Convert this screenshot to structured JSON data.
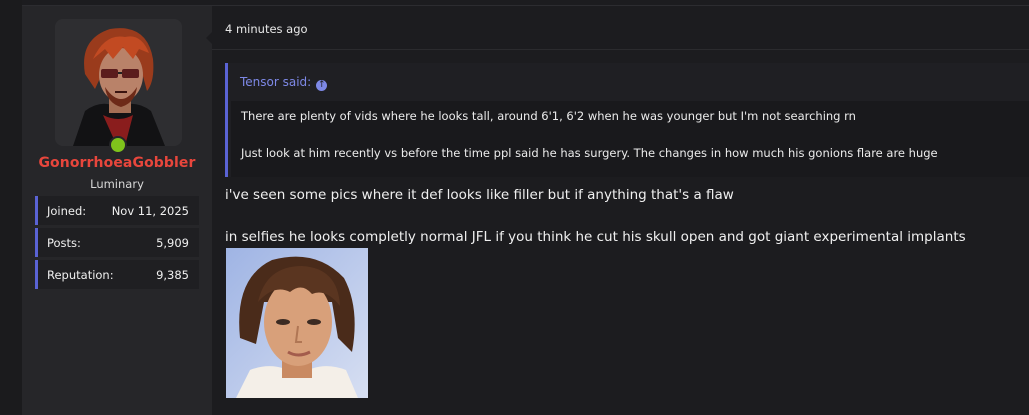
{
  "colors": {
    "accent": "#5a63d4",
    "username": "#e8463c",
    "online": "#7fc31c",
    "quote_link": "#7d88e6"
  },
  "user": {
    "name": "GonorrhoeaGobbler",
    "title": "Luminary",
    "online": true,
    "stats": [
      {
        "label": "Joined:",
        "value": "Nov 11, 2025"
      },
      {
        "label": "Posts:",
        "value": "5,909"
      },
      {
        "label": "Reputation:",
        "value": "9,385"
      }
    ]
  },
  "post": {
    "timestamp": "4 minutes ago",
    "quote": {
      "author": "Tensor said:",
      "jump_icon": "arrow-up-circle-icon",
      "lines": [
        "There are plenty of vids where he looks tall, around 6'1, 6'2 when he was younger but I'm not searching rn",
        "Just look at him recently vs before the time ppl said he has surgery. The changes in how much his gonions flare are huge"
      ]
    },
    "body": [
      "i've seen some pics where it def looks like filler but if anything that's a flaw",
      "in selfies he looks completly normal JFL if you think he cut his skull open and got giant experimental implants"
    ]
  }
}
